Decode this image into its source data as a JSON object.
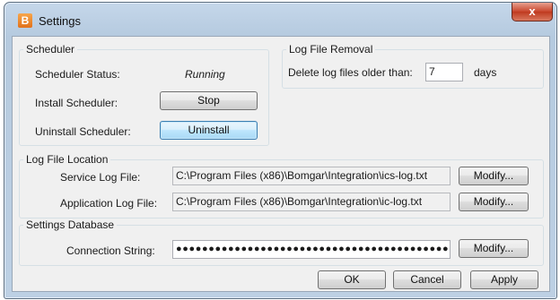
{
  "window": {
    "title": "Settings",
    "app_icon_letter": "B",
    "close_glyph": "x",
    "colors": {
      "close": "#c9462c",
      "app_icon": "#e8781f"
    }
  },
  "scheduler": {
    "group_title": "Scheduler",
    "status_label": "Scheduler Status:",
    "status_value": "Running",
    "install_label": "Install Scheduler:",
    "install_button": "Stop",
    "uninstall_label": "Uninstall Scheduler:",
    "uninstall_button": "Uninstall"
  },
  "log_removal": {
    "group_title": "Log File Removal",
    "prefix_label": "Delete log files older than:",
    "days_value": "7",
    "suffix_label": "days"
  },
  "log_location": {
    "group_title": "Log File Location",
    "service_label": "Service Log File:",
    "service_path": "C:\\Program Files (x86)\\Bomgar\\Integration\\ics-log.txt",
    "service_button": "Modify...",
    "application_label": "Application Log File:",
    "application_path": "C:\\Program Files (x86)\\Bomgar\\Integration\\ic-log.txt",
    "application_button": "Modify..."
  },
  "database": {
    "group_title": "Settings Database",
    "connection_label": "Connection String:",
    "connection_value": "●●●●●●●●●●●●●●●●●●●●●●●●●●●●●●●●●●●●●●●●●●●●●●●●●●",
    "modify_button": "Modify..."
  },
  "footer": {
    "ok": "OK",
    "cancel": "Cancel",
    "apply": "Apply"
  }
}
